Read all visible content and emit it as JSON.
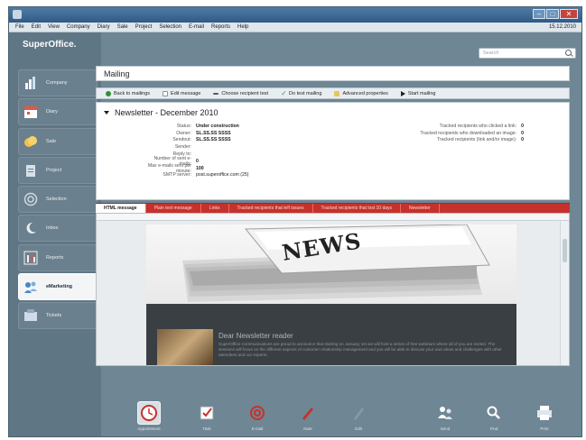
{
  "window": {
    "title": ""
  },
  "menubar": {
    "items": [
      "File",
      "Edit",
      "View",
      "Company",
      "Diary",
      "Sale",
      "Project",
      "Selection",
      "E-mail",
      "Reports",
      "Help"
    ],
    "date": "15.12.2010"
  },
  "sidebar": {
    "logo": "SuperOffice.",
    "items": [
      {
        "label": "Company",
        "icon": "company-chart-icon",
        "color": "#f2f6fa"
      },
      {
        "label": "Diary",
        "icon": "calendar-icon",
        "color": "#e25547"
      },
      {
        "label": "Sale",
        "icon": "coins-icon",
        "color": "#f2c24a"
      },
      {
        "label": "Project",
        "icon": "clipboard-icon",
        "color": "#d5e0ea"
      },
      {
        "label": "Selection",
        "icon": "target-icon",
        "color": "#cfd8df"
      },
      {
        "label": "Inbox",
        "icon": "moon-icon",
        "color": "#e9eef2"
      },
      {
        "label": "Reports",
        "icon": "bars-icon",
        "color": "#f0f2f4"
      },
      {
        "label": "eMarketing",
        "icon": "emarketing-icon",
        "color": "#4a86c5"
      },
      {
        "label": "Tickets",
        "icon": "ticket-icon",
        "color": "#cfdbe7"
      }
    ]
  },
  "search": {
    "placeholder": "Search"
  },
  "mailing": {
    "title": "Mailing",
    "toolbar": [
      {
        "label": "Back to mailings",
        "icon": "back-icon",
        "color": "#2f8f3a"
      },
      {
        "label": "Edit message",
        "icon": "edit-icon",
        "color": "#ffffff"
      },
      {
        "label": "Choose recipient test",
        "icon": "arrows-icon",
        "color": "#4d5b66"
      },
      {
        "label": "Do test mailing",
        "icon": "check-icon",
        "color": "#44a045"
      },
      {
        "label": "Advanced properties",
        "icon": "properties-icon",
        "color": "#e9c65a"
      },
      {
        "label": "Start mailing",
        "icon": "play-icon",
        "color": "#222222"
      }
    ],
    "newsletter_title": "Newsletter - December 2010",
    "details_left": [
      {
        "key": "Status:",
        "value": "Under construction"
      },
      {
        "key": "Owner:",
        "value": "SL.SS.SS SSSS"
      },
      {
        "key": "Sendout:",
        "value": "SL.SS.SS SSSS"
      },
      {
        "key": "Sender:",
        "value": ""
      },
      {
        "key": "Reply to:",
        "value": ""
      },
      {
        "key": "Number of sent e-mails:",
        "value": "0"
      },
      {
        "key": "Max e-mails sent per minute:",
        "value": "100"
      },
      {
        "key": "SMTP server:",
        "value": "post.superoffice.com (25)"
      }
    ],
    "details_right": [
      {
        "key": "Tracked recipients who clicked a link:",
        "value": "0"
      },
      {
        "key": "Tracked recipients who downloaded an image:",
        "value": "0"
      },
      {
        "key": "Tracked recipients (link and/or image):",
        "value": "0"
      }
    ],
    "tabs": [
      "HTML message",
      "Plain text message",
      "Links",
      "Tracked recipients that left issues",
      "Tracked recipients that lost 10 days",
      "Newsletter"
    ]
  },
  "email_preview": {
    "image_text": "NEWS",
    "heading": "Dear Newsletter reader",
    "body": "SuperOffice Communications are proud to announce that starting on January 1st we will host a series of free webinars where all of you are invited. The sessions will focus on the different aspects of customer relationship management and you will be able to discuss your own ideas and challenges with other attendees and our experts."
  },
  "bottom_toolbar": [
    {
      "label": "Appointment",
      "icon": "clock-icon",
      "active": true
    },
    {
      "label": "Task",
      "icon": "task-check-icon",
      "active": false
    },
    {
      "label": "E-mail",
      "icon": "at-icon",
      "active": false
    },
    {
      "label": "Note",
      "icon": "pen-icon",
      "active": false
    },
    {
      "label": "Edit",
      "icon": "pencil-icon",
      "active": false
    },
    {
      "label": "Send",
      "icon": "people-icon",
      "active": false
    },
    {
      "label": "Find",
      "icon": "find-icon",
      "active": false
    },
    {
      "label": "Print",
      "icon": "printer-icon",
      "active": false
    }
  ]
}
